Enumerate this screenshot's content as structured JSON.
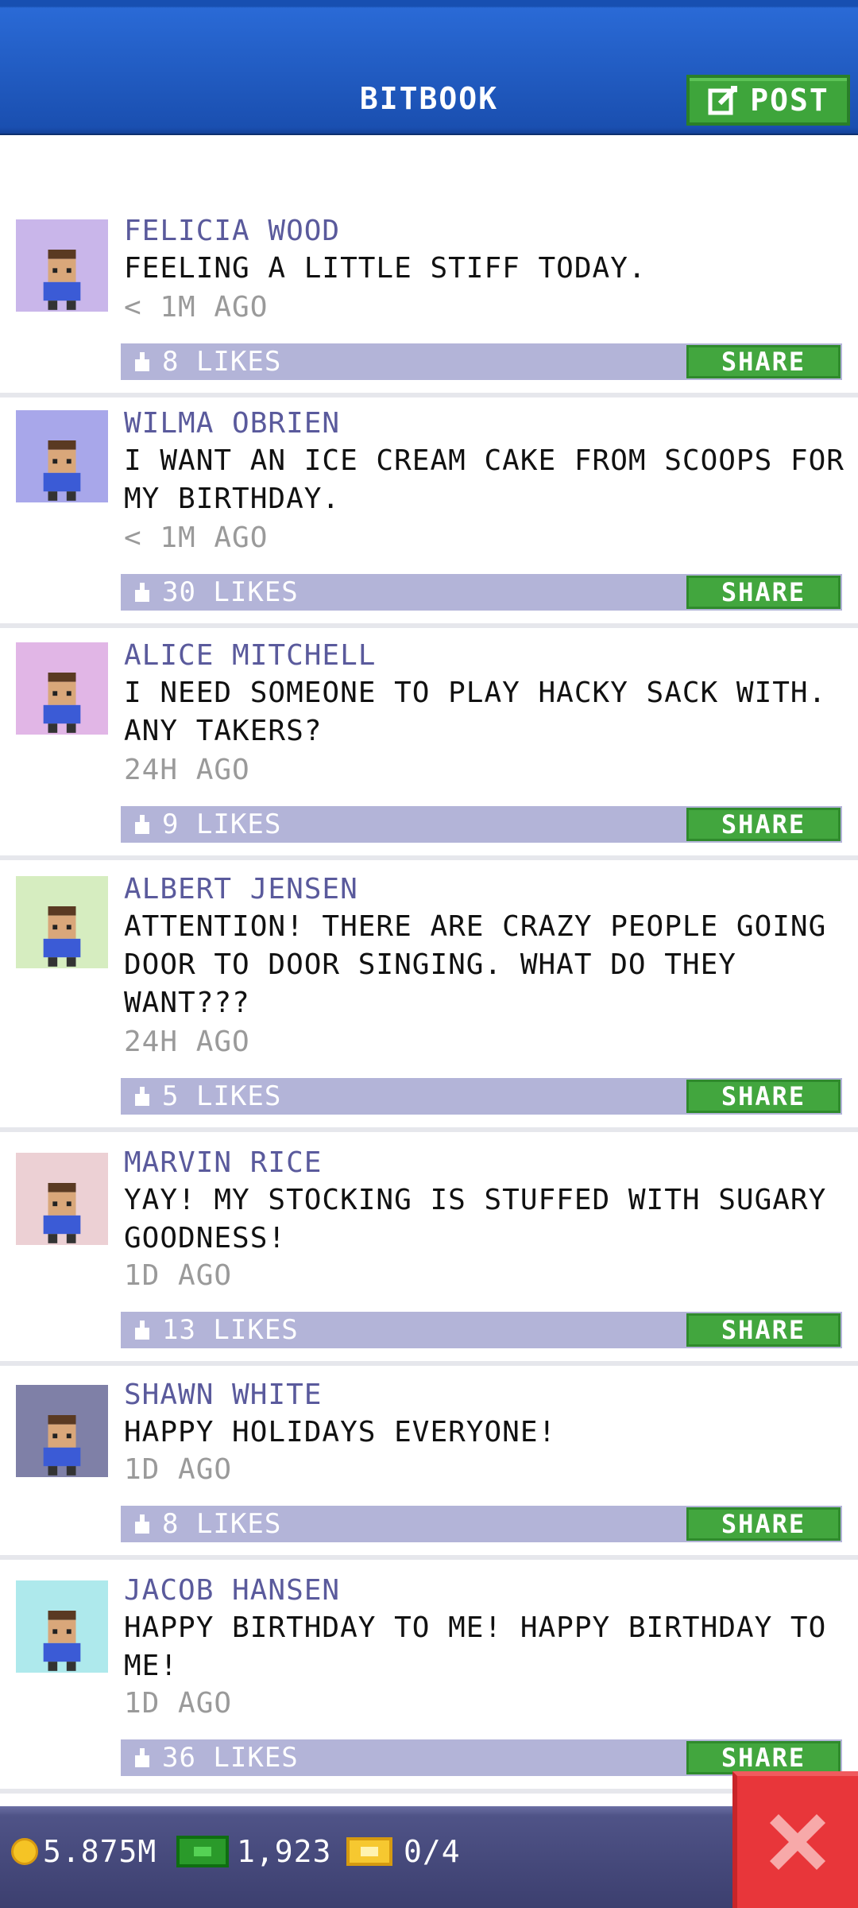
{
  "header": {
    "title": "BITBOOK",
    "post_label": "POST"
  },
  "posts": [
    {
      "name": "FELICIA WOOD",
      "text": "FEELING A LITTLE STIFF TODAY.",
      "time": "< 1M AGO",
      "likes": "8 LIKES",
      "share": "SHARE",
      "avatar_bg": "#c9b6ea"
    },
    {
      "name": "WILMA OBRIEN",
      "text": "I WANT AN ICE CREAM CAKE FROM SCOOPS FOR MY BIRTHDAY.",
      "time": "< 1M AGO",
      "likes": "30 LIKES",
      "share": "SHARE",
      "avatar_bg": "#a8a7ea"
    },
    {
      "name": "ALICE MITCHELL",
      "text": "I NEED SOMEONE TO PLAY HACKY SACK WITH. ANY TAKERS?",
      "time": "24H AGO",
      "likes": "9 LIKES",
      "share": "SHARE",
      "avatar_bg": "#e1b6e6"
    },
    {
      "name": "ALBERT JENSEN",
      "text": "ATTENTION! THERE ARE CRAZY PEOPLE GOING DOOR TO DOOR SINGING. WHAT DO THEY WANT???",
      "time": "24H AGO",
      "likes": "5 LIKES",
      "share": "SHARE",
      "avatar_bg": "#d6edc0"
    },
    {
      "name": "MARVIN RICE",
      "text": "YAY! MY STOCKING IS STUFFED WITH SUGARY GOODNESS!",
      "time": "1D AGO",
      "likes": "13 LIKES",
      "share": "SHARE",
      "avatar_bg": "#ecd0d4"
    },
    {
      "name": "SHAWN WHITE",
      "text": "HAPPY HOLIDAYS EVERYONE!",
      "time": "1D AGO",
      "likes": "8 LIKES",
      "share": "SHARE",
      "avatar_bg": "#7f80a7"
    },
    {
      "name": "JACOB HANSEN",
      "text": "HAPPY BIRTHDAY TO ME! HAPPY BIRTHDAY TO ME!",
      "time": "1D AGO",
      "likes": "36 LIKES",
      "share": "SHARE",
      "avatar_bg": "#aee9ec"
    }
  ],
  "bottom_bar": {
    "coins": "5.875M",
    "bux": "1,923",
    "tickets": "0/4"
  },
  "colors": {
    "header_blue": "#1a4fb0",
    "accent_green": "#42a63e",
    "like_bar": "#b3b4d8",
    "name_color": "#5a5a9c",
    "close_red": "#e8363a"
  }
}
